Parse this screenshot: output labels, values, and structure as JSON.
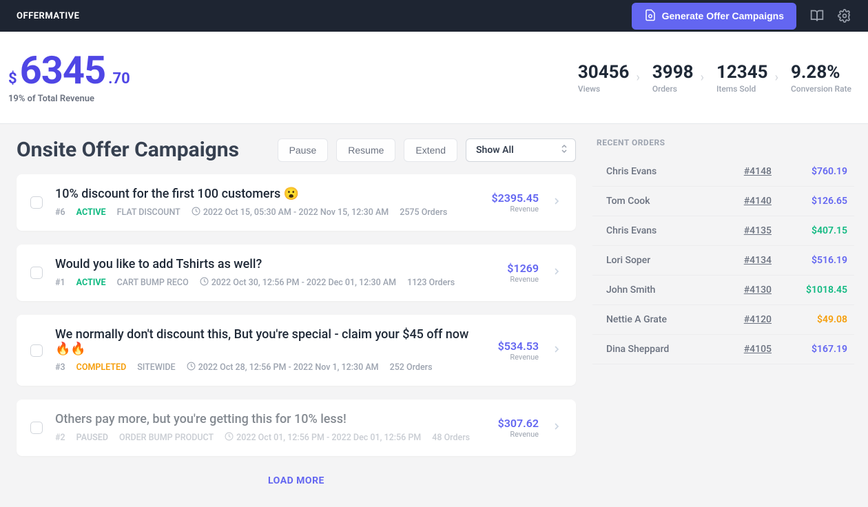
{
  "header": {
    "brand": "OFFERMATIVE",
    "generate_btn": "Generate Offer Campaigns"
  },
  "revenue": {
    "currency": "$",
    "amount_main": "6345",
    "amount_cents": ".70",
    "subtitle": "19% of Total Revenue"
  },
  "stats": [
    {
      "value": "30456",
      "label": "Views"
    },
    {
      "value": "3998",
      "label": "Orders"
    },
    {
      "value": "12345",
      "label": "Items Sold"
    },
    {
      "value": "9.28%",
      "label": "Conversion Rate"
    }
  ],
  "page": {
    "title": "Onsite Offer Campaigns",
    "btn_pause": "Pause",
    "btn_resume": "Resume",
    "btn_extend": "Extend",
    "filter_selected": "Show All",
    "load_more": "LOAD MORE"
  },
  "campaigns": [
    {
      "title": "10% discount for the first 100 customers 😮",
      "idx": "#6",
      "status": "ACTIVE",
      "status_class": "status-active",
      "type": "FLAT DISCOUNT",
      "date": "2022 Oct 15, 05:30 AM - 2022 Nov 15, 12:30 AM",
      "orders": "2575 Orders",
      "revenue": "$2395.45",
      "rev_label": "Revenue",
      "dim": false
    },
    {
      "title": "Would you like to add Tshirts as well?",
      "idx": "#1",
      "status": "ACTIVE",
      "status_class": "status-active",
      "type": "CART BUMP RECO",
      "date": "2022 Oct 30, 12:56 PM - 2022 Dec 01, 12:30 AM",
      "orders": "1123 Orders",
      "revenue": "$1269",
      "rev_label": "Revenue",
      "dim": false
    },
    {
      "title": "We normally don't discount this, But you're special - claim your $45 off now 🔥🔥",
      "idx": "#3",
      "status": "COMPLETED",
      "status_class": "status-completed",
      "type": "SITEWIDE",
      "date": "2022 Oct 28, 12:56 PM - 2022 Nov 1, 12:30 AM",
      "orders": "252 Orders",
      "revenue": "$534.53",
      "rev_label": "Revenue",
      "dim": false
    },
    {
      "title": "Others pay more, but you're getting this for 10% less!",
      "idx": "#2",
      "status": "PAUSED",
      "status_class": "status-paused",
      "type": "ORDER BUMP PRODUCT",
      "date": "2022 Oct 01, 12:56 PM - 2022 Dec 01, 12:56 PM",
      "orders": "48 Orders",
      "revenue": "$307.62",
      "rev_label": "Revenue",
      "dim": true
    }
  ],
  "recent_orders": {
    "title": "RECENT ORDERS",
    "rows": [
      {
        "name": "Chris Evans",
        "id": "#4148",
        "amount": "$760.19",
        "color": "amt-blue"
      },
      {
        "name": "Tom Cook",
        "id": "#4140",
        "amount": "$126.65",
        "color": "amt-blue"
      },
      {
        "name": "Chris Evans",
        "id": "#4135",
        "amount": "$407.15",
        "color": "amt-green"
      },
      {
        "name": "Lori Soper",
        "id": "#4134",
        "amount": "$516.19",
        "color": "amt-blue"
      },
      {
        "name": "John Smith",
        "id": "#4130",
        "amount": "$1018.45",
        "color": "amt-green"
      },
      {
        "name": "Nettie A Grate",
        "id": "#4120",
        "amount": "$49.08",
        "color": "amt-orange"
      },
      {
        "name": "Dina Sheppard",
        "id": "#4105",
        "amount": "$167.19",
        "color": "amt-blue"
      }
    ]
  }
}
